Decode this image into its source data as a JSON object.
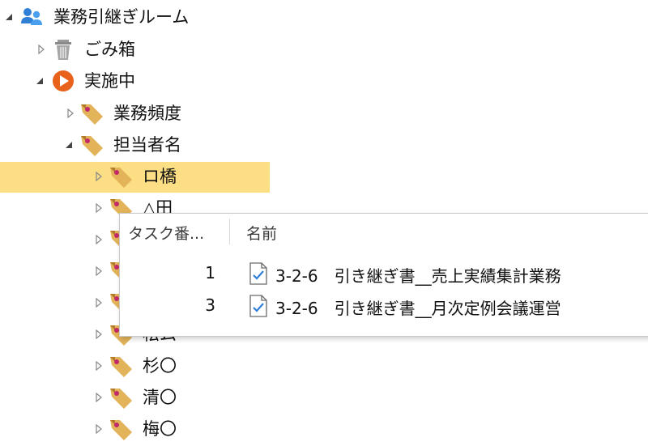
{
  "tree": {
    "root": {
      "label": "業務引継ぎルーム",
      "icon": "users-icon"
    },
    "trash": {
      "label": "ごみ箱",
      "icon": "trash-icon"
    },
    "active": {
      "label": "実施中",
      "icon": "play-circle-icon"
    },
    "frequency": {
      "label": "業務頻度",
      "icon": "tag-icon"
    },
    "owner": {
      "label": "担当者名",
      "icon": "tag-icon"
    },
    "people": [
      {
        "label": "ロ橋",
        "selected": true
      },
      {
        "label": "△田"
      },
      {
        "label": ""
      },
      {
        "label": ""
      },
      {
        "label": ""
      },
      {
        "label": "松ム"
      },
      {
        "label": "杉〇"
      },
      {
        "label": "清〇"
      },
      {
        "label": "梅〇"
      }
    ]
  },
  "popup": {
    "columns": {
      "number": "タスク番...",
      "name": "名前"
    },
    "rows": [
      {
        "number": "1",
        "name": "3-2-6　引き継ぎ書__売上実績集計業務",
        "icon": "task-checked-icon"
      },
      {
        "number": "3",
        "name": "3-2-6　引き継ぎ書__月次定例会議運営",
        "icon": "task-checked-icon"
      }
    ]
  },
  "colors": {
    "selection": "#fcdf84",
    "play": "#e8621c",
    "users": "#2f7fd6",
    "tag": "#e3b35a"
  }
}
